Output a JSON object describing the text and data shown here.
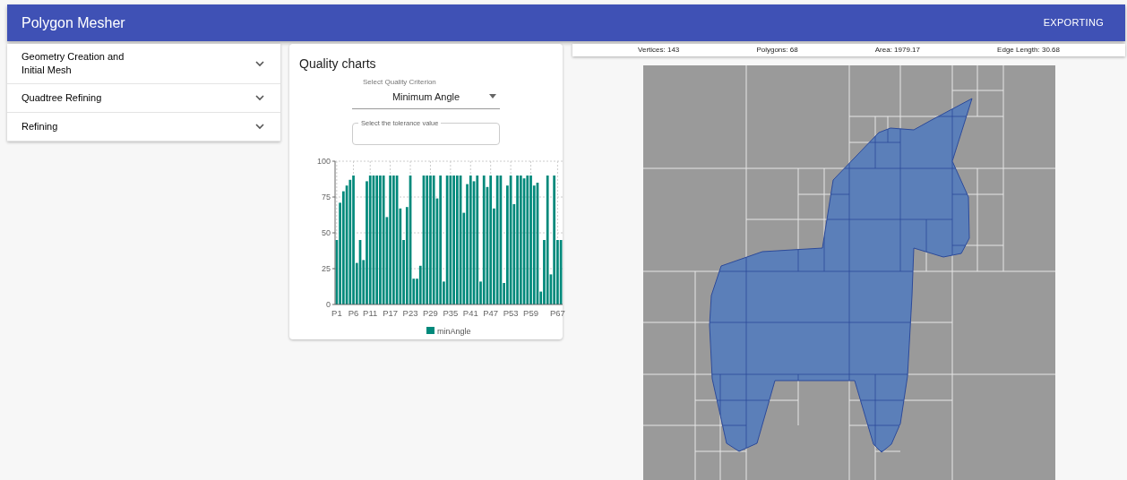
{
  "app_bar": {
    "title": "Polygon Mesher",
    "action": "EXPORTING"
  },
  "accordion": [
    {
      "title": "Geometry Creation and Initial Mesh",
      "expanded": false
    },
    {
      "title": "Quadtree Refining",
      "expanded": false
    },
    {
      "title": "Refining",
      "expanded": false
    }
  ],
  "quality_card": {
    "title": "Quality charts",
    "criterion_select": {
      "label": "Select Quality Criterion",
      "value": "Minimum Angle"
    },
    "tolerance_field": {
      "label": "Select the tolerance value"
    },
    "chart_data": {
      "type": "bar",
      "grid": true,
      "categories": [
        "P1",
        null,
        null,
        null,
        null,
        "P6",
        null,
        null,
        null,
        null,
        "P11",
        null,
        null,
        null,
        null,
        null,
        "P17",
        null,
        null,
        null,
        null,
        null,
        "P23",
        null,
        null,
        null,
        null,
        null,
        "P29",
        null,
        null,
        null,
        null,
        null,
        "P35",
        null,
        null,
        null,
        null,
        null,
        "P41",
        null,
        null,
        null,
        null,
        null,
        "P47",
        null,
        null,
        null,
        null,
        null,
        "P53",
        null,
        null,
        null,
        null,
        null,
        "P59",
        null,
        null,
        null,
        null,
        null,
        null,
        null,
        "P67",
        null
      ],
      "series": [
        {
          "name": "minAngle",
          "color": "#00897b",
          "values": [
            45,
            71,
            79,
            83,
            87,
            90,
            29,
            45,
            31,
            86,
            90,
            90,
            90,
            90,
            90,
            61,
            90,
            90,
            90,
            67,
            45,
            68,
            90,
            18,
            18,
            27,
            90,
            90,
            90,
            90,
            74,
            90,
            16,
            90,
            90,
            90,
            90,
            90,
            64,
            84,
            90,
            86,
            90,
            16,
            90,
            82,
            90,
            67,
            90,
            90,
            15,
            83,
            90,
            70,
            90,
            90,
            88,
            90,
            90,
            83,
            85,
            9,
            45,
            90,
            21,
            90,
            45,
            45
          ]
        }
      ],
      "ylim": [
        0,
        100
      ],
      "yticks": [
        0,
        25,
        50,
        75,
        100
      ]
    }
  },
  "stats": [
    "Vertices: 143",
    "Polygons: 68",
    "Area: 1979.17",
    "Edge Length: 30.68"
  ]
}
